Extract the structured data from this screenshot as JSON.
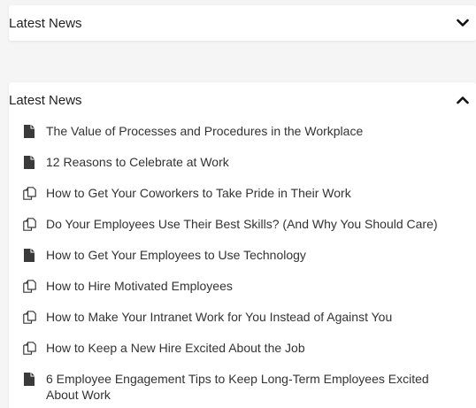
{
  "collapsed_panel": {
    "title": "Latest News",
    "state_icon": "chevron-down-icon"
  },
  "expanded_panel": {
    "title": "Latest News",
    "state_icon": "chevron-up-icon",
    "items": [
      {
        "icon": "document-icon",
        "label": "The Value of Processes and Procedures in the Workplace"
      },
      {
        "icon": "document-icon",
        "label": "12 Reasons to Celebrate at Work"
      },
      {
        "icon": "copy-document-icon",
        "label": "How to Get Your Coworkers to Take Pride in Their Work"
      },
      {
        "icon": "copy-document-icon",
        "label": "Do Your Employees Use Their Best Skills? (And Why You Should Care)"
      },
      {
        "icon": "document-icon",
        "label": "How to Get Your Employees to Use Technology"
      },
      {
        "icon": "copy-document-icon",
        "label": "How to Hire Motivated Employees"
      },
      {
        "icon": "copy-document-icon",
        "label": "How to Make Your Intranet Work for You Instead of Against You"
      },
      {
        "icon": "copy-document-icon",
        "label": "How to Keep a New Hire Excited About the Job"
      },
      {
        "icon": "document-icon",
        "label": "6 Employee Engagement Tips to Keep Long-Term Employees Excited About Work"
      }
    ]
  },
  "colors": {
    "background": "#f5f5f5",
    "panel": "#ffffff",
    "text": "#333333",
    "icon": "#3a3a3a"
  }
}
